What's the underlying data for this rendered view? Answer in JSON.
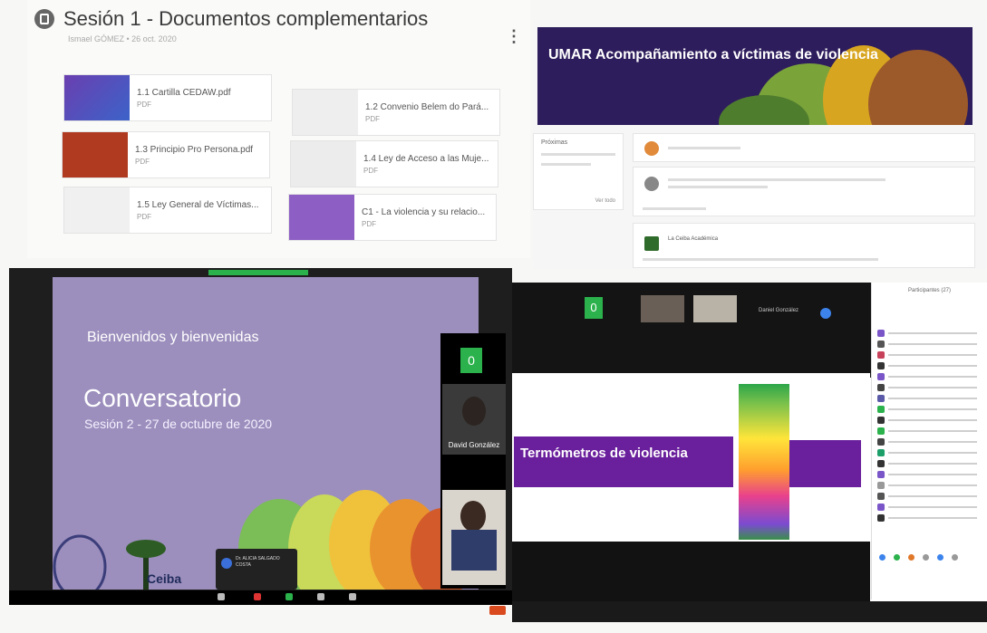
{
  "documents_panel": {
    "title": "Sesión 1 - Documentos complementarios",
    "subtitle": "Ismael GÓMEZ • 26 oct. 2020",
    "attachments": [
      {
        "name": "1.1 Cartilla CEDAW.pdf",
        "type": "PDF"
      },
      {
        "name": "1.2 Convenio Belem do Pará...",
        "type": "PDF"
      },
      {
        "name": "1.3 Principio Pro Persona.pdf",
        "type": "PDF"
      },
      {
        "name": "1.4 Ley de Acceso a las Muje...",
        "type": "PDF"
      },
      {
        "name": "1.5 Ley General de Víctimas...",
        "type": "PDF"
      },
      {
        "name": "C1 - La violencia y su relacio...",
        "type": "PDF"
      }
    ]
  },
  "class_panel": {
    "banner_title": "UMAR Acompañamiento a víctimas de violencia",
    "sidebar_label": "Próximas",
    "view_all": "Ver todo",
    "poster_name": "La Ceiba Académica"
  },
  "zoom_left": {
    "slide_welcome": "Bienvenidos y bienvenidas",
    "slide_title": "Conversatorio",
    "slide_session": "Sesión 2 - 27 de octubre de 2020",
    "participant_count_tile": "0",
    "speaker_name": "David González",
    "popup_name": "Dr. ALICIA SALGADO COSTA",
    "footer_text": "Ceiba"
  },
  "zoom_right": {
    "tile_label": "0",
    "slide_title": "Termómetros de violencia",
    "panel_title": "Participantes (27)",
    "chat_name": "Daniel González"
  }
}
